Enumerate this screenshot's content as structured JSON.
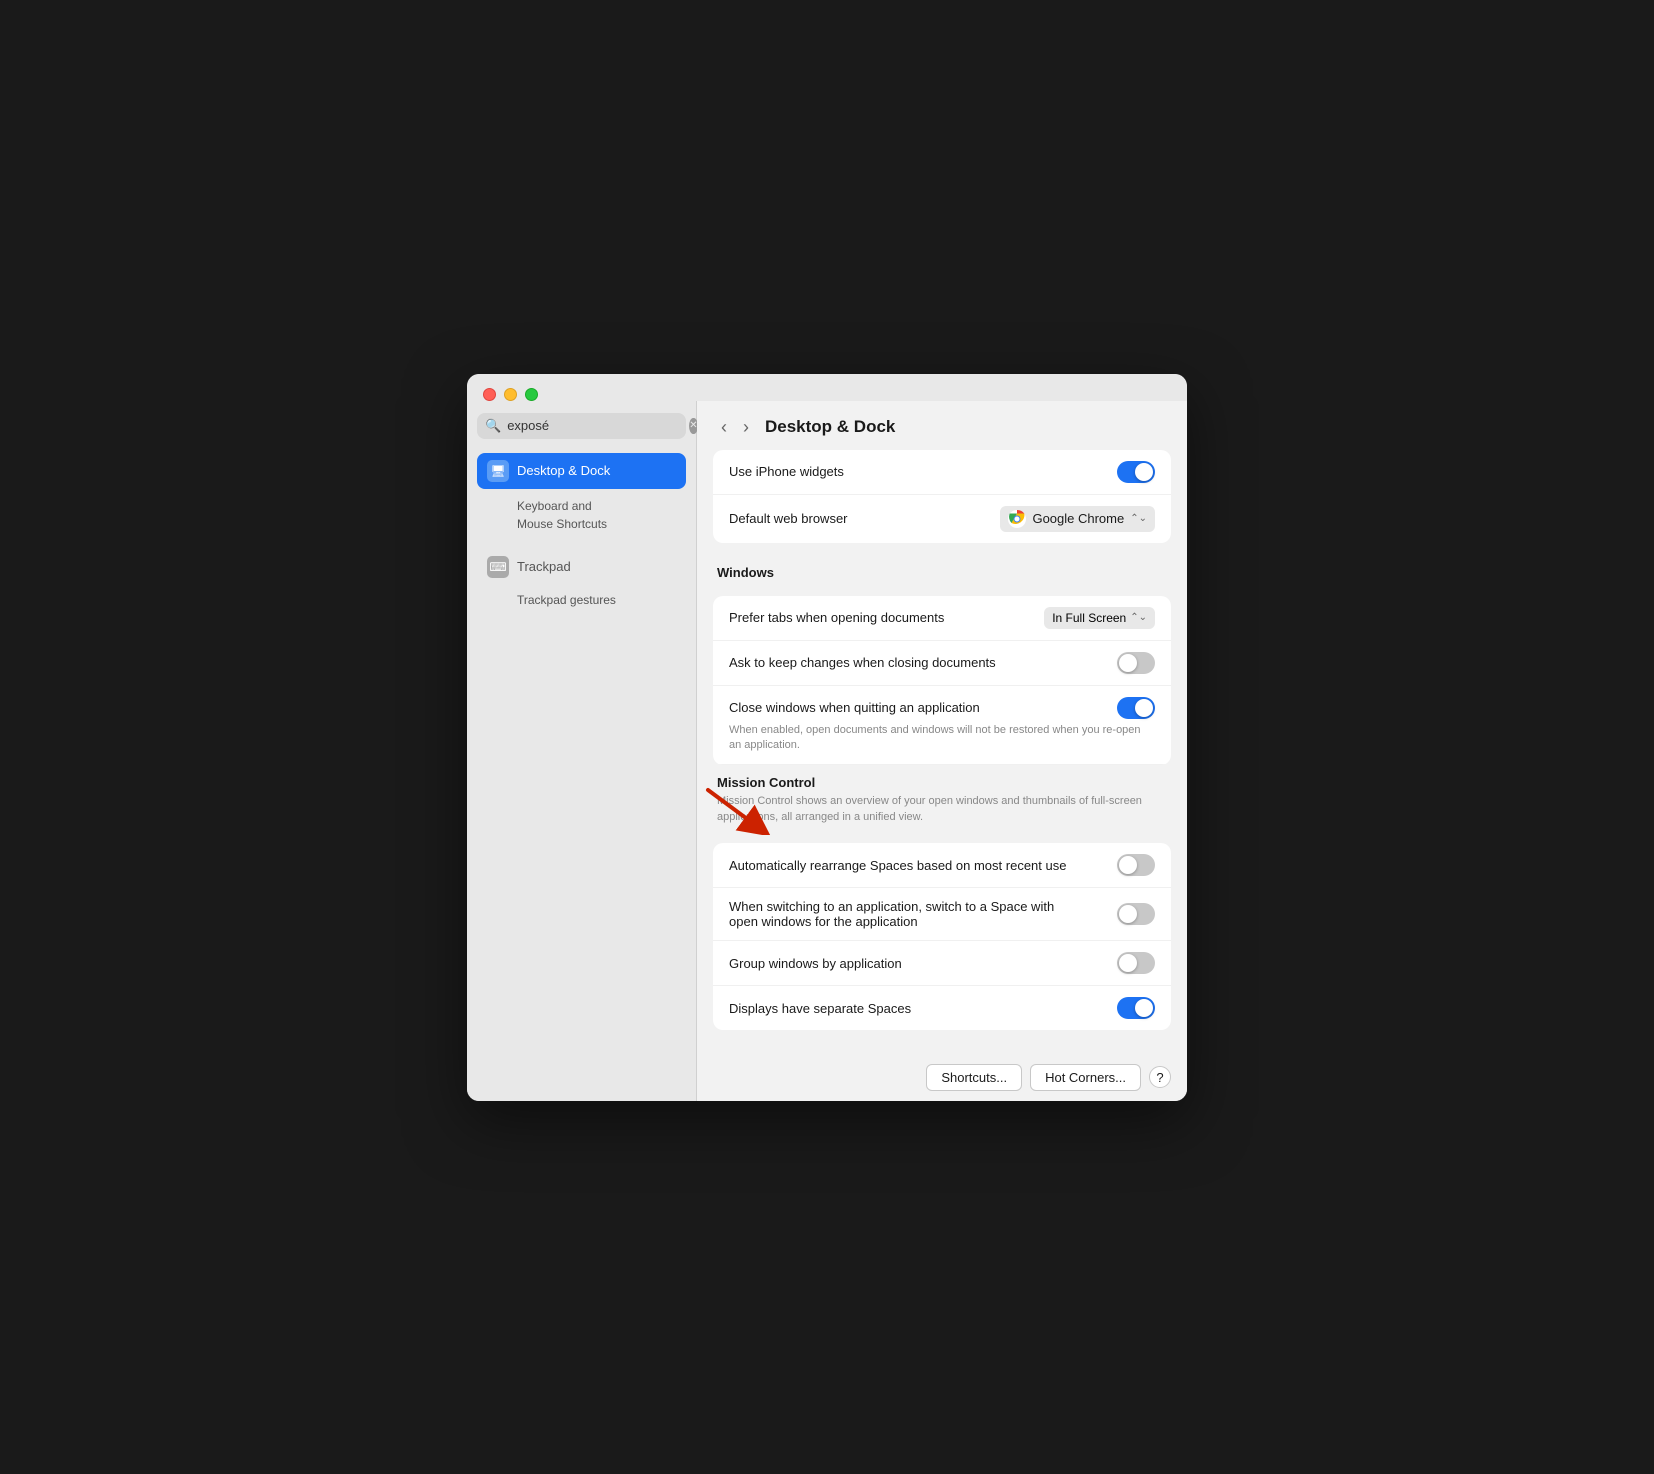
{
  "window": {
    "title": "Desktop & Dock"
  },
  "sidebar": {
    "search_placeholder": "exposé",
    "active_item": {
      "label": "Desktop & Dock",
      "icon": "🖥"
    },
    "sub_items": [
      {
        "label": "Keyboard and\nMouse Shortcuts"
      }
    ],
    "parent_items": [
      {
        "label": "Trackpad",
        "icon": "⌨",
        "sub_items": [
          {
            "label": "Trackpad gestures"
          }
        ]
      }
    ]
  },
  "nav": {
    "back_label": "‹",
    "forward_label": "›",
    "title": "Desktop & Dock"
  },
  "settings": {
    "use_iphone_widgets": {
      "label": "Use iPhone widgets",
      "toggle": true
    },
    "default_web_browser": {
      "label": "Default web browser",
      "value": "Google Chrome"
    },
    "windows_section": "Windows",
    "prefer_tabs": {
      "label": "Prefer tabs when opening documents",
      "value": "In Full Screen"
    },
    "ask_keep_changes": {
      "label": "Ask to keep changes when closing documents",
      "toggle": false
    },
    "close_windows": {
      "label": "Close windows when quitting an application",
      "desc": "When enabled, open documents and windows will not be restored when you re-open an application.",
      "toggle": true
    },
    "mission_control": {
      "title": "Mission Control",
      "desc": "Mission Control shows an overview of your open windows and thumbnails of full-screen applications, all arranged in a unified view."
    },
    "auto_rearrange": {
      "label": "Automatically rearrange Spaces based on most recent use",
      "toggle": false
    },
    "switch_application": {
      "label": "When switching to an application, switch to a Space with open windows for the application",
      "toggle": false
    },
    "group_windows": {
      "label": "Group windows by application",
      "toggle": false
    },
    "displays_separate": {
      "label": "Displays have separate Spaces",
      "toggle": true
    }
  },
  "bottom_bar": {
    "shortcuts_btn": "Shortcuts...",
    "hot_corners_btn": "Hot Corners...",
    "help_btn": "?"
  }
}
